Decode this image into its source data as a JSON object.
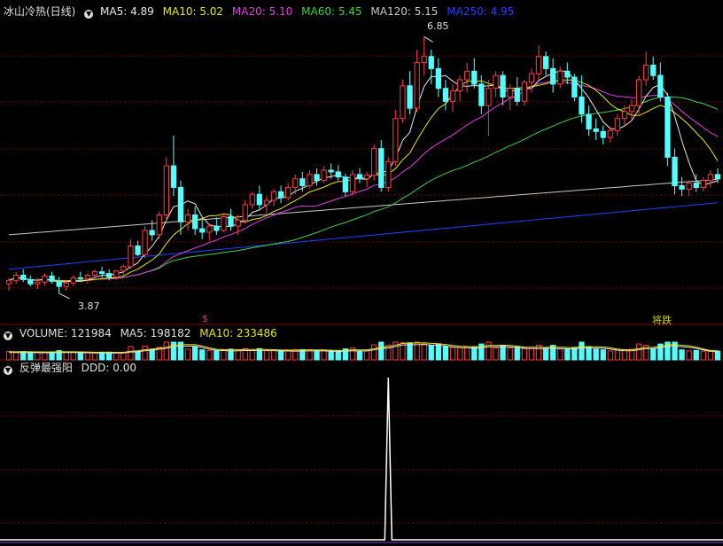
{
  "main_panel": {
    "title": "冰山冷热(日线)",
    "ma": [
      {
        "label": "MA5: 4.89",
        "color": "#e8e8e8"
      },
      {
        "label": "MA10: 5.02",
        "color": "#e8e800"
      },
      {
        "label": "MA20: 5.10",
        "color": "#e040e0"
      },
      {
        "label": "MA60: 5.45",
        "color": "#40d040"
      },
      {
        "label": "MA120: 5.15",
        "color": "#c8c8c8"
      },
      {
        "label": "MA250: 4.95",
        "color": "#2040ff"
      }
    ],
    "high_label": "6.85",
    "low_label": "3.87",
    "signal_buy": "$",
    "signal_label": "将跌"
  },
  "volume_panel": {
    "title": "VOLUME: 121984",
    "ma5": "MA5: 198182",
    "ma10": "MA10: 233486"
  },
  "indicator_panel": {
    "title": "反弹最强阳",
    "value": "DDD: 0.00"
  },
  "chart_data": [
    {
      "type": "candlestick",
      "title": "冰山冷热(日线)",
      "annotations": {
        "high": 6.85,
        "low": 3.87
      },
      "series": [
        {
          "name": "MA5",
          "last": 4.89
        },
        {
          "name": "MA10",
          "last": 5.02
        },
        {
          "name": "MA20",
          "last": 5.1
        },
        {
          "name": "MA60",
          "last": 5.45
        },
        {
          "name": "MA120",
          "last": 5.15
        },
        {
          "name": "MA250",
          "last": 4.95
        }
      ],
      "ohlc": [
        [
          3.98,
          4.05,
          3.9,
          4.02
        ],
        [
          4.02,
          4.12,
          3.98,
          4.08
        ],
        [
          4.08,
          4.15,
          4.0,
          4.03
        ],
        [
          4.03,
          4.08,
          3.95,
          3.98
        ],
        [
          3.98,
          4.05,
          3.92,
          4.0
        ],
        [
          4.0,
          4.1,
          3.96,
          4.07
        ],
        [
          4.07,
          4.12,
          3.98,
          4.01
        ],
        [
          4.01,
          4.06,
          3.87,
          3.95
        ],
        [
          3.95,
          4.02,
          3.9,
          3.99
        ],
        [
          3.99,
          4.08,
          3.95,
          4.05
        ],
        [
          4.05,
          4.12,
          4.0,
          4.04
        ],
        [
          4.04,
          4.1,
          3.98,
          4.08
        ],
        [
          4.08,
          4.15,
          4.02,
          4.12
        ],
        [
          4.12,
          4.18,
          4.05,
          4.1
        ],
        [
          4.1,
          4.15,
          4.02,
          4.06
        ],
        [
          4.06,
          4.14,
          4.03,
          4.13
        ],
        [
          4.13,
          4.2,
          4.08,
          4.18
        ],
        [
          4.18,
          4.5,
          4.15,
          4.42
        ],
        [
          4.42,
          4.48,
          4.3,
          4.32
        ],
        [
          4.32,
          4.65,
          4.28,
          4.6
        ],
        [
          4.6,
          4.72,
          4.48,
          4.55
        ],
        [
          4.55,
          4.82,
          4.5,
          4.78
        ],
        [
          4.78,
          5.45,
          4.7,
          5.35
        ],
        [
          5.35,
          5.7,
          5.0,
          5.1
        ],
        [
          5.1,
          5.18,
          4.55,
          4.7
        ],
        [
          4.7,
          4.85,
          4.6,
          4.78
        ],
        [
          4.78,
          4.88,
          4.55,
          4.62
        ],
        [
          4.62,
          4.72,
          4.5,
          4.58
        ],
        [
          4.58,
          4.68,
          4.48,
          4.65
        ],
        [
          4.65,
          4.75,
          4.55,
          4.6
        ],
        [
          4.6,
          4.8,
          4.58,
          4.76
        ],
        [
          4.76,
          4.85,
          4.6,
          4.65
        ],
        [
          4.65,
          4.78,
          4.55,
          4.72
        ],
        [
          4.72,
          4.95,
          4.68,
          4.9
        ],
        [
          4.9,
          5.05,
          4.85,
          5.02
        ],
        [
          5.02,
          5.12,
          4.85,
          4.9
        ],
        [
          4.9,
          5.0,
          4.8,
          4.95
        ],
        [
          4.95,
          5.08,
          4.88,
          5.05
        ],
        [
          5.05,
          5.12,
          4.92,
          4.98
        ],
        [
          4.98,
          5.15,
          4.95,
          5.1
        ],
        [
          5.1,
          5.25,
          5.02,
          5.2
        ],
        [
          5.2,
          5.28,
          5.05,
          5.12
        ],
        [
          5.12,
          5.3,
          5.08,
          5.25
        ],
        [
          5.25,
          5.32,
          5.12,
          5.18
        ],
        [
          5.18,
          5.35,
          5.15,
          5.3
        ],
        [
          5.3,
          5.38,
          5.2,
          5.28
        ],
        [
          5.28,
          5.36,
          5.18,
          5.22
        ],
        [
          5.22,
          5.26,
          5.0,
          5.05
        ],
        [
          5.05,
          5.3,
          5.0,
          5.25
        ],
        [
          5.25,
          5.32,
          5.15,
          5.2
        ],
        [
          5.2,
          5.28,
          5.1,
          5.24
        ],
        [
          5.24,
          5.6,
          5.18,
          5.55
        ],
        [
          5.55,
          5.65,
          5.05,
          5.1
        ],
        [
          5.1,
          5.45,
          5.05,
          5.4
        ],
        [
          5.4,
          6.0,
          5.35,
          5.9
        ],
        [
          5.9,
          6.35,
          5.85,
          6.28
        ],
        [
          6.28,
          6.45,
          5.95,
          6.02
        ],
        [
          6.02,
          6.7,
          5.98,
          6.55
        ],
        [
          6.55,
          6.85,
          6.4,
          6.62
        ],
        [
          6.62,
          6.7,
          6.3,
          6.48
        ],
        [
          6.48,
          6.6,
          6.15,
          6.25
        ],
        [
          6.25,
          6.35,
          6.0,
          6.1
        ],
        [
          6.1,
          6.3,
          5.98,
          6.22
        ],
        [
          6.22,
          6.4,
          6.1,
          6.35
        ],
        [
          6.35,
          6.55,
          6.2,
          6.45
        ],
        [
          6.45,
          6.6,
          6.25,
          6.3
        ],
        [
          6.3,
          6.4,
          5.95,
          6.05
        ],
        [
          6.05,
          6.35,
          5.7,
          6.25
        ],
        [
          6.25,
          6.45,
          6.15,
          6.4
        ],
        [
          6.4,
          6.45,
          6.05,
          6.15
        ],
        [
          6.15,
          6.3,
          6.0,
          6.25
        ],
        [
          6.25,
          6.38,
          6.05,
          6.1
        ],
        [
          6.1,
          6.35,
          6.05,
          6.32
        ],
        [
          6.32,
          6.48,
          6.2,
          6.42
        ],
        [
          6.42,
          6.75,
          6.35,
          6.62
        ],
        [
          6.62,
          6.68,
          6.4,
          6.48
        ],
        [
          6.48,
          6.6,
          6.2,
          6.3
        ],
        [
          6.3,
          6.5,
          6.25,
          6.45
        ],
        [
          6.45,
          6.55,
          6.3,
          6.38
        ],
        [
          6.38,
          6.42,
          6.1,
          6.15
        ],
        [
          6.15,
          6.4,
          5.85,
          5.95
        ],
        [
          5.95,
          6.05,
          5.7,
          5.78
        ],
        [
          5.78,
          5.9,
          5.65,
          5.75
        ],
        [
          5.75,
          5.82,
          5.6,
          5.68
        ],
        [
          5.68,
          5.8,
          5.62,
          5.76
        ],
        [
          5.76,
          5.95,
          5.7,
          5.9
        ],
        [
          5.9,
          6.05,
          5.82,
          5.98
        ],
        [
          5.98,
          6.12,
          5.88,
          6.05
        ],
        [
          6.05,
          6.4,
          5.95,
          6.35
        ],
        [
          6.35,
          6.68,
          6.28,
          6.52
        ],
        [
          6.52,
          6.62,
          6.35,
          6.4
        ],
        [
          6.4,
          6.55,
          6.1,
          6.15
        ],
        [
          6.15,
          6.2,
          5.35,
          5.45
        ],
        [
          5.45,
          5.55,
          5.02,
          5.12
        ],
        [
          5.12,
          5.22,
          5.0,
          5.08
        ],
        [
          5.08,
          5.18,
          5.0,
          5.15
        ],
        [
          5.15,
          5.25,
          5.05,
          5.1
        ],
        [
          5.1,
          5.22,
          5.05,
          5.18
        ],
        [
          5.18,
          5.3,
          5.1,
          5.25
        ],
        [
          5.25,
          5.32,
          5.15,
          5.2
        ]
      ]
    },
    {
      "type": "bar",
      "title": "VOLUME",
      "series": [
        {
          "name": "VOLUME",
          "last": 121984
        },
        {
          "name": "MA5",
          "last": 198182
        },
        {
          "name": "MA10",
          "last": 233486
        }
      ]
    },
    {
      "type": "line",
      "title": "反弹最强阳",
      "series": [
        {
          "name": "DDD",
          "last": 0.0,
          "spike_at_index": 53,
          "spike_value": 1
        }
      ]
    }
  ],
  "colors": {
    "up": "#ff3b3b",
    "down": "#54ffff",
    "grid": "#7a0000",
    "bg": "#000000",
    "ma5": "#e8e8e8",
    "ma10": "#e8e800",
    "ma20": "#e040e0",
    "ma60": "#40d040",
    "ma120": "#c8c8c8",
    "ma250": "#2040ff",
    "signal": "#ff3030",
    "warn": "#d0d000"
  }
}
